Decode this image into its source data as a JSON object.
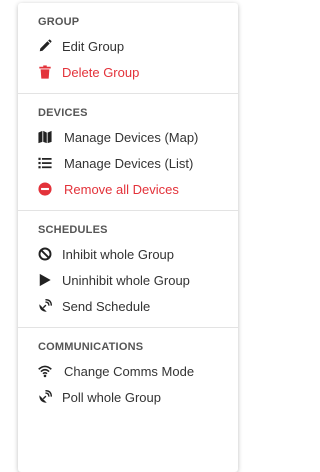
{
  "colors": {
    "danger": "#e3323a",
    "text": "#333333",
    "heading": "#555555"
  },
  "menu": {
    "group": {
      "title": "GROUP",
      "items": [
        {
          "label": "Edit Group",
          "icon": "pencil-icon"
        },
        {
          "label": "Delete Group",
          "icon": "trash-icon",
          "danger": true
        }
      ]
    },
    "devices": {
      "title": "DEVICES",
      "items": [
        {
          "label": "Manage Devices (Map)",
          "icon": "map-icon"
        },
        {
          "label": "Manage Devices (List)",
          "icon": "list-icon"
        },
        {
          "label": "Remove all Devices",
          "icon": "minus-circle-icon",
          "danger": true
        }
      ]
    },
    "schedules": {
      "title": "SCHEDULES",
      "items": [
        {
          "label": "Inhibit whole Group",
          "icon": "ban-icon"
        },
        {
          "label": "Uninhibit whole Group",
          "icon": "play-icon"
        },
        {
          "label": "Send Schedule",
          "icon": "satellite-dish-icon"
        }
      ]
    },
    "communications": {
      "title": "COMMUNICATIONS",
      "items": [
        {
          "label": "Change Comms Mode",
          "icon": "wifi-icon"
        },
        {
          "label": "Poll whole Group",
          "icon": "satellite-dish-icon"
        }
      ]
    }
  }
}
